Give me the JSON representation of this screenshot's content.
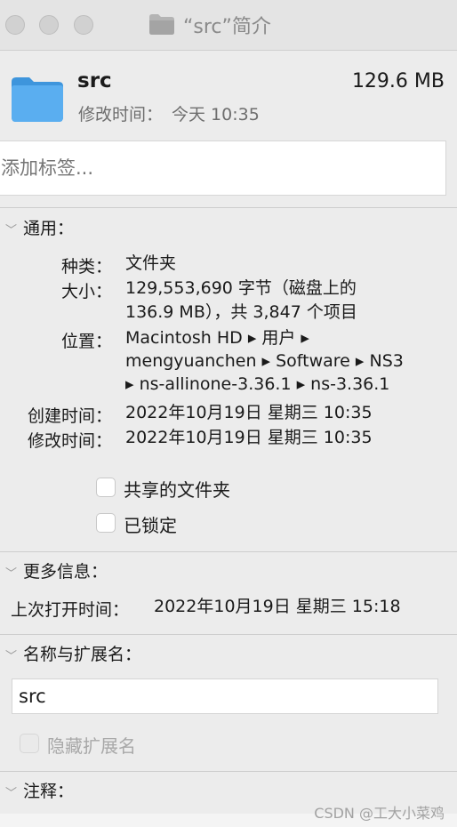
{
  "window": {
    "title": "“src”简介"
  },
  "header": {
    "name": "src",
    "size": "129.6 MB",
    "modified_label": "修改时间：",
    "modified_value": "今天 10:35"
  },
  "tags": {
    "placeholder": "添加标签..."
  },
  "general": {
    "heading": "通用：",
    "kind_label": "种类：",
    "kind_value": "文件夹",
    "size_label": "大小：",
    "size_line1": "129,553,690 字节（磁盘上的",
    "size_line2": "136.9 MB），共 3,847 个项目",
    "where_label": "位置：",
    "where_line1": "Macintosh HD ▸ 用户 ▸",
    "where_line2": "mengyuanchen ▸ Software ▸ NS3",
    "where_line3": "▸ ns-allinone-3.36.1 ▸ ns-3.36.1",
    "created_label": "创建时间：",
    "created_value": "2022年10月19日 星期三 10:35",
    "modified_label": "修改时间：",
    "modified_value": "2022年10月19日 星期三 10:35",
    "shared_label": "共享的文件夹",
    "locked_label": "已锁定"
  },
  "more_info": {
    "heading": "更多信息：",
    "last_opened_label": "上次打开时间：",
    "last_opened_value": "2022年10月19日 星期三 15:18"
  },
  "name_ext": {
    "heading": "名称与扩展名：",
    "name_value": "src",
    "hide_ext_label": "隐藏扩展名"
  },
  "comments": {
    "heading": "注释："
  },
  "watermark": "CSDN @工大小菜鸡",
  "colors": {
    "folder": "#5aaef0",
    "folder_dark": "#3e95dc"
  }
}
